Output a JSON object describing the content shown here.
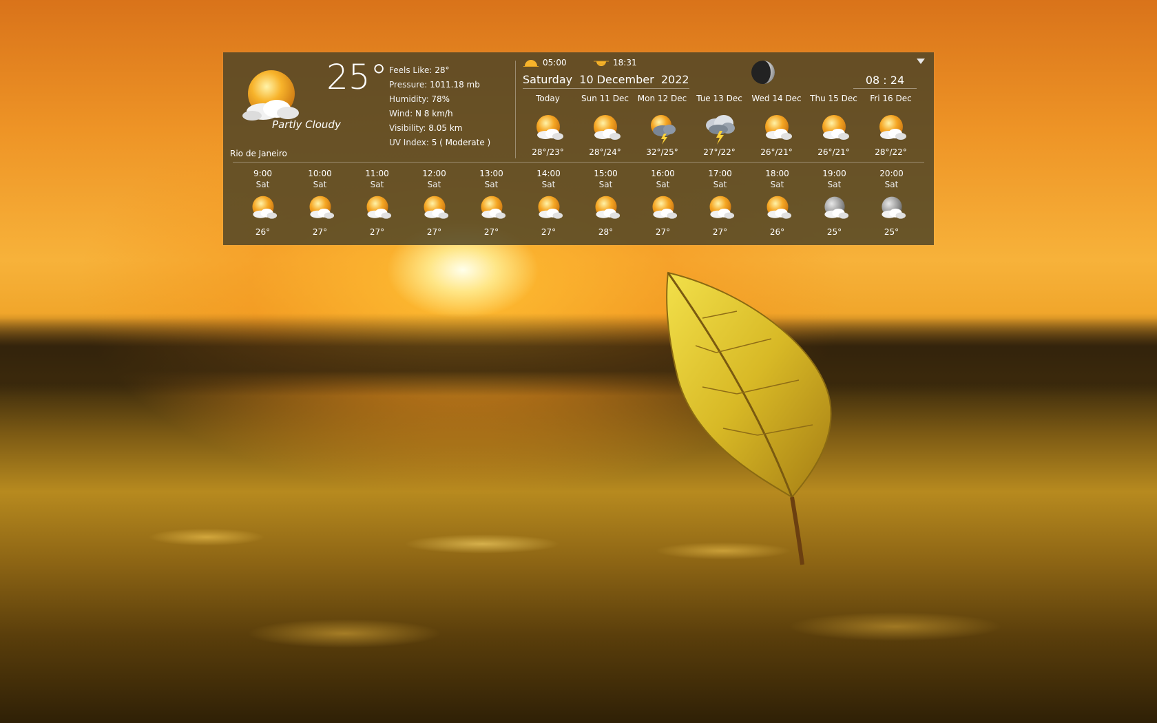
{
  "current": {
    "temp": "25°",
    "condition": "Partly Cloudy",
    "city": "Rio de Janeiro",
    "icon": "partly-cloudy-icon",
    "details": [
      {
        "label": "Feels Like:",
        "value": " 28°"
      },
      {
        "label": "Pressure:",
        "value": " 1011.18 mb"
      },
      {
        "label": "Humidity:",
        "value": " 78%"
      },
      {
        "label": "Wind:",
        "value": " N 8 km/h"
      },
      {
        "label": "Visibility:",
        "value": " 8.05 km"
      },
      {
        "label": "UV Index:",
        "value": " 5 ( Moderate )"
      }
    ]
  },
  "sun": {
    "sunrise": "05:00",
    "sunset": "18:31"
  },
  "date": "Saturday  10 December  2022",
  "time": "08 : 24",
  "moon_icon": "moon-phase-icon",
  "daily": [
    {
      "name": "Today",
      "range": "28°/23°",
      "icon": "partly-cloudy"
    },
    {
      "name": "Sun 11 Dec",
      "range": "28°/24°",
      "icon": "partly-cloudy"
    },
    {
      "name": "Mon 12 Dec",
      "range": "32°/25°",
      "icon": "thunderstorm-sun"
    },
    {
      "name": "Tue 13 Dec",
      "range": "27°/22°",
      "icon": "thunderstorm"
    },
    {
      "name": "Wed 14 Dec",
      "range": "26°/21°",
      "icon": "partly-cloudy"
    },
    {
      "name": "Thu 15 Dec",
      "range": "26°/21°",
      "icon": "partly-cloudy"
    },
    {
      "name": "Fri 16 Dec",
      "range": "28°/22°",
      "icon": "partly-cloudy"
    }
  ],
  "hourly": [
    {
      "time": "9:00",
      "day": "Sat",
      "temp": "26°",
      "icon": "partly-cloudy"
    },
    {
      "time": "10:00",
      "day": "Sat",
      "temp": "27°",
      "icon": "partly-cloudy"
    },
    {
      "time": "11:00",
      "day": "Sat",
      "temp": "27°",
      "icon": "partly-cloudy"
    },
    {
      "time": "12:00",
      "day": "Sat",
      "temp": "27°",
      "icon": "partly-cloudy"
    },
    {
      "time": "13:00",
      "day": "Sat",
      "temp": "27°",
      "icon": "partly-cloudy"
    },
    {
      "time": "14:00",
      "day": "Sat",
      "temp": "27°",
      "icon": "partly-cloudy"
    },
    {
      "time": "15:00",
      "day": "Sat",
      "temp": "28°",
      "icon": "partly-cloudy"
    },
    {
      "time": "16:00",
      "day": "Sat",
      "temp": "27°",
      "icon": "partly-cloudy"
    },
    {
      "time": "17:00",
      "day": "Sat",
      "temp": "27°",
      "icon": "partly-cloudy"
    },
    {
      "time": "18:00",
      "day": "Sat",
      "temp": "26°",
      "icon": "partly-cloudy"
    },
    {
      "time": "19:00",
      "day": "Sat",
      "temp": "25°",
      "icon": "moon-cloudy"
    },
    {
      "time": "20:00",
      "day": "Sat",
      "temp": "25°",
      "icon": "moon-cloudy"
    }
  ],
  "colors": {
    "panel": "#4e4426",
    "sun": "#f5a623",
    "cloud": "#f2f2f2",
    "background": "#ee9426"
  }
}
